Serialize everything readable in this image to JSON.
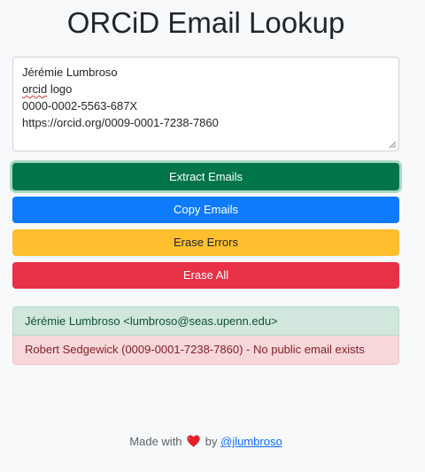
{
  "page": {
    "title": "ORCiD Email Lookup"
  },
  "input": {
    "lines": [
      "Jérémie Lumbroso",
      "orcid",
      "logo",
      "0000-0002-5563-687X",
      "https://orcid.org/0009-0001-7238-7860"
    ]
  },
  "buttons": {
    "extract_label": "Extract Emails",
    "copy_label": "Copy Emails",
    "erase_errors_label": "Erase Errors",
    "erase_all_label": "Erase All"
  },
  "results": [
    {
      "status": "success",
      "text": "Jérémie Lumbroso <lumbroso@seas.upenn.edu>"
    },
    {
      "status": "error",
      "text": "Robert Sedgewick (0009-0001-7238-7860) - No public email exists"
    }
  ],
  "footer": {
    "prefix": "Made with",
    "by": "by",
    "link_text": "@jlumbroso",
    "heart_icon": "heart-icon"
  },
  "colors": {
    "extract": "#00754a",
    "copy": "#0d7bfb",
    "erase_errors": "#ffbf2e",
    "erase_all": "#e83146",
    "success_bg": "#d1e7dd",
    "error_bg": "#f8d7da",
    "link": "#0d6efd"
  }
}
